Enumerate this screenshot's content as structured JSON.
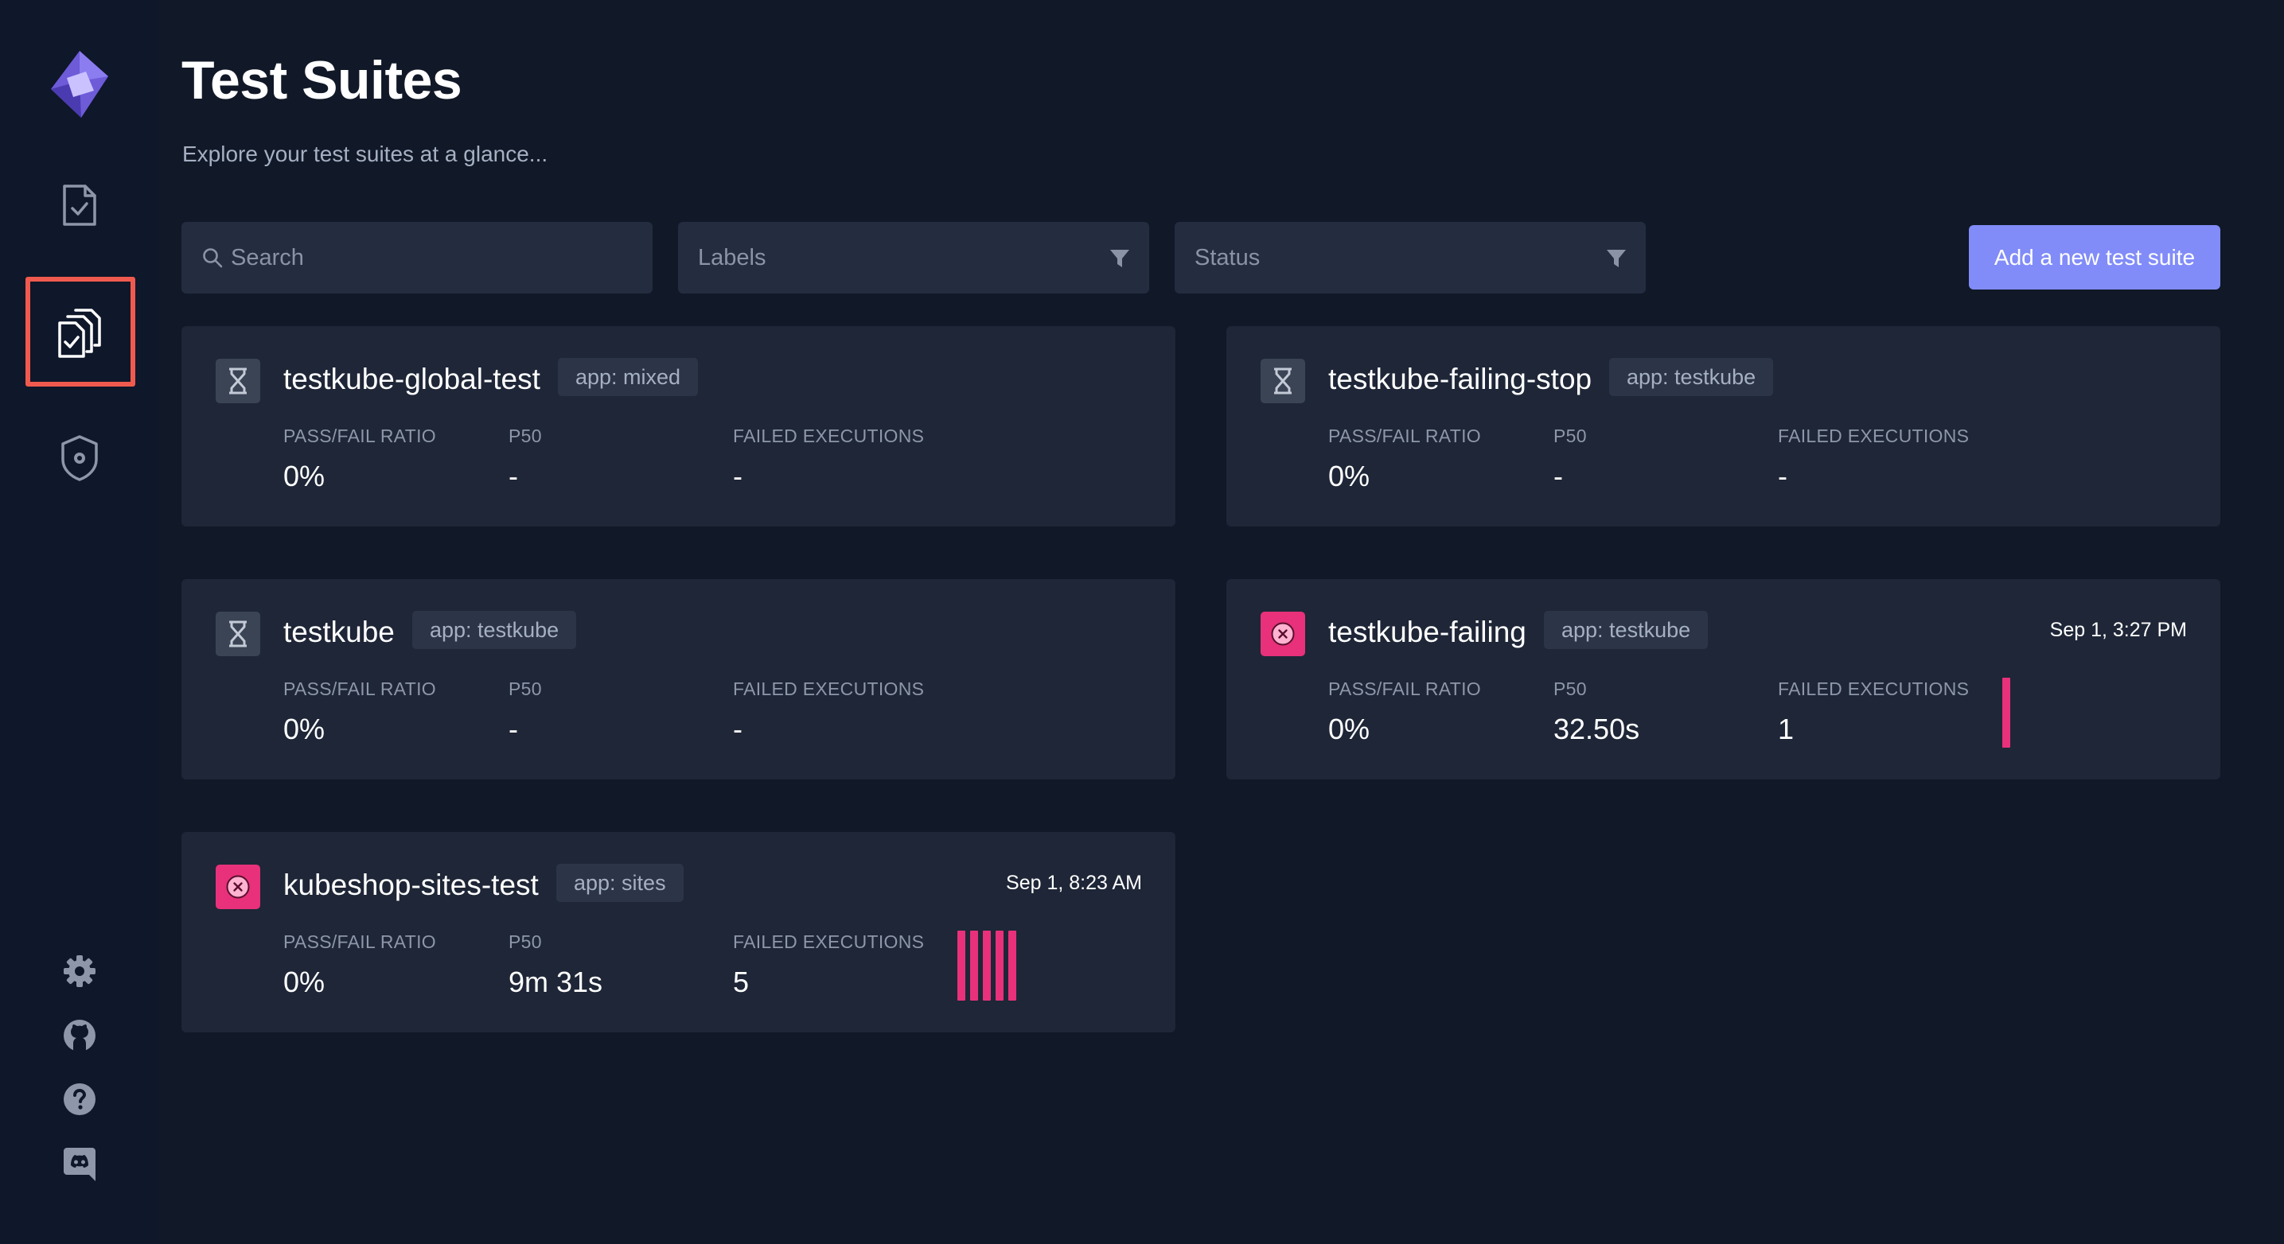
{
  "page": {
    "title": "Test Suites",
    "subtitle": "Explore your test suites at a glance..."
  },
  "filters": {
    "search_placeholder": "Search",
    "labels_placeholder": "Labels",
    "status_placeholder": "Status"
  },
  "actions": {
    "add_label": "Add a new test suite"
  },
  "sidebar": {
    "items": [
      {
        "icon": "logo-icon"
      },
      {
        "icon": "tests-icon"
      },
      {
        "icon": "test-suites-icon",
        "active": true
      },
      {
        "icon": "executors-icon"
      },
      {
        "icon": "settings-icon"
      },
      {
        "icon": "github-icon"
      },
      {
        "icon": "help-icon"
      },
      {
        "icon": "discord-icon"
      }
    ]
  },
  "metric_labels": {
    "ratio": "PASS/FAIL RATIO",
    "p50": "P50",
    "failed": "FAILED EXECUTIONS"
  },
  "colors": {
    "accent": "#818cf8",
    "failed": "#e8317a",
    "pending": "#3a4455",
    "highlight": "#f05a4e"
  },
  "suites": [
    {
      "name": "testkube-global-test",
      "label": "app: mixed",
      "status": "pending",
      "date": "",
      "ratio": "0%",
      "p50": "-",
      "failed": "-",
      "failed_bars": 0
    },
    {
      "name": "testkube-failing-stop",
      "label": "app: testkube",
      "status": "pending",
      "date": "",
      "ratio": "0%",
      "p50": "-",
      "failed": "-",
      "failed_bars": 0
    },
    {
      "name": "testkube",
      "label": "app: testkube",
      "status": "pending",
      "date": "",
      "ratio": "0%",
      "p50": "-",
      "failed": "-",
      "failed_bars": 0
    },
    {
      "name": "testkube-failing",
      "label": "app: testkube",
      "status": "failed",
      "date": "Sep 1, 3:27 PM",
      "ratio": "0%",
      "p50": "32.50s",
      "failed": "1",
      "failed_bars": 1
    },
    {
      "name": "kubeshop-sites-test",
      "label": "app: sites",
      "status": "failed",
      "date": "Sep 1, 8:23 AM",
      "ratio": "0%",
      "p50": "9m 31s",
      "failed": "5",
      "failed_bars": 5
    }
  ]
}
